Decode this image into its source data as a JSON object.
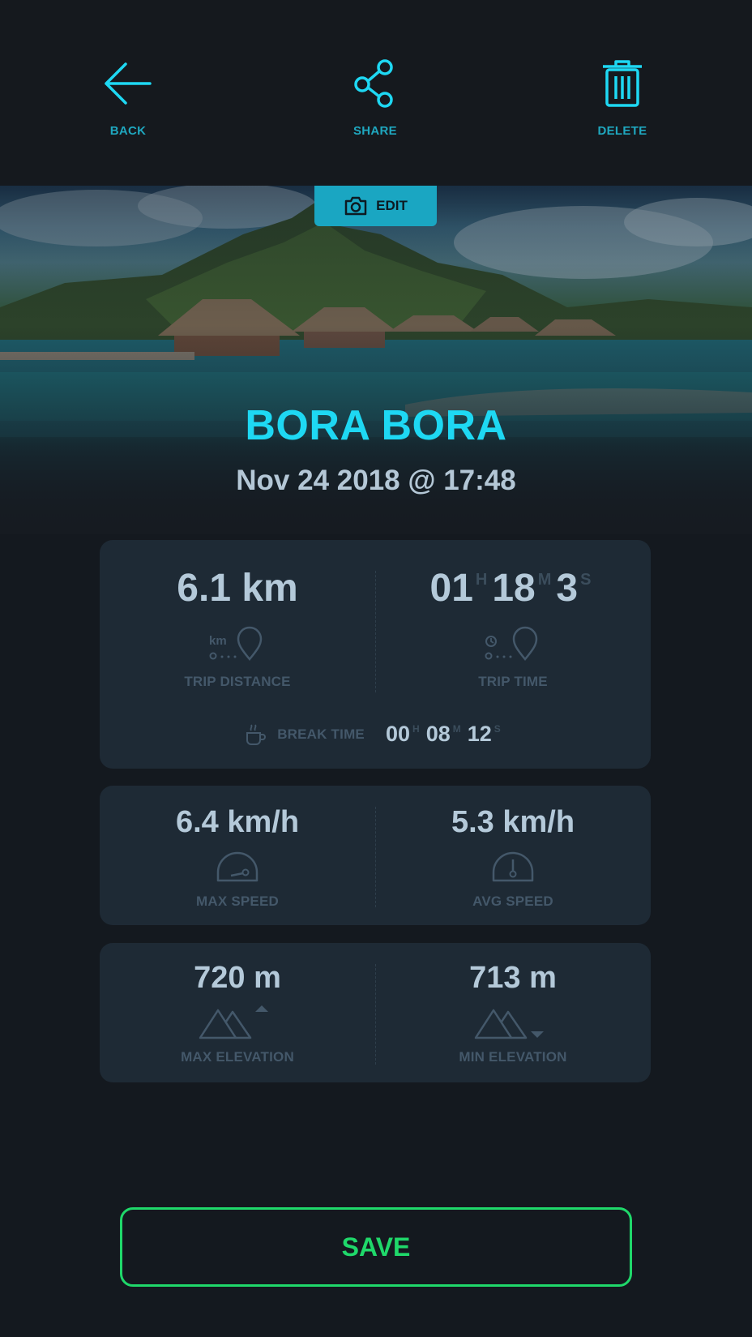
{
  "toolbar": {
    "back_label": "BACK",
    "share_label": "SHARE",
    "delete_label": "DELETE"
  },
  "hero": {
    "edit_label": "EDIT",
    "trip_name": "BORA BORA",
    "trip_datetime": "Nov 24 2018 @ 17:48"
  },
  "stats": {
    "trip_distance": {
      "value": "6.1 km",
      "label": "TRIP DISTANCE",
      "icon_text": "km"
    },
    "trip_time": {
      "hours": "01",
      "h": "H",
      "minutes": "18",
      "m": "M",
      "seconds": "3",
      "s": "S",
      "label": "TRIP TIME"
    },
    "break_time": {
      "label": "BREAK TIME",
      "hours": "00",
      "h": "H",
      "minutes": "08",
      "m": "M",
      "seconds": "12",
      "s": "S"
    },
    "max_speed": {
      "value": "6.4 km/h",
      "label": "MAX SPEED"
    },
    "avg_speed": {
      "value": "5.3 km/h",
      "label": "AVG SPEED"
    },
    "max_elevation": {
      "value": "720 m",
      "label": "MAX ELEVATION"
    },
    "min_elevation": {
      "value": "713 m",
      "label": "MIN ELEVATION"
    }
  },
  "actions": {
    "save_label": "SAVE"
  },
  "colors": {
    "accent": "#1ed8f3",
    "save": "#1fd86a",
    "background": "#14191f",
    "card": "#1e2a35"
  }
}
